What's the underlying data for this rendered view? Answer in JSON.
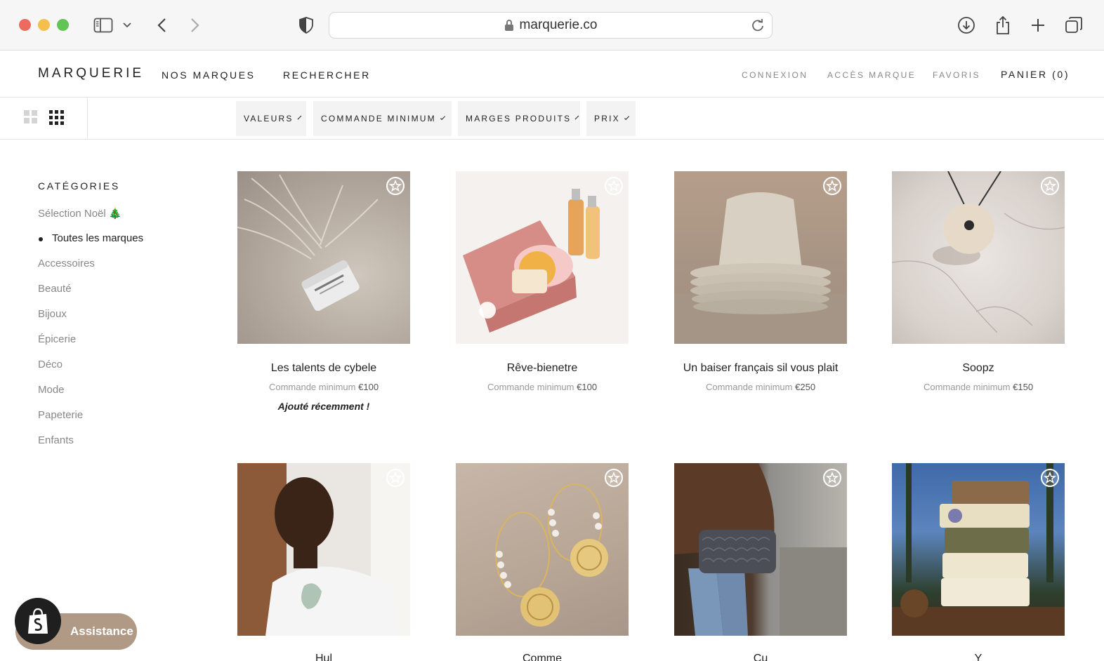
{
  "browser": {
    "url": "marquerie.co"
  },
  "header": {
    "logo": "MARQUERIE",
    "nav": [
      "NOS MARQUES",
      "RECHERCHER"
    ],
    "right_links": [
      "CONNEXION",
      "ACCÈS MARQUE",
      "FAVORIS"
    ],
    "cart": "PANIER (0)"
  },
  "filters": [
    "VALEURS",
    "COMMANDE MINIMUM",
    "MARGES PRODUITS",
    "PRIX"
  ],
  "sidebar": {
    "title": "CATÉGORIES",
    "items": [
      {
        "label": "Sélection Noël 🎄",
        "active": false
      },
      {
        "label": "Toutes les marques",
        "active": true
      },
      {
        "label": "Accessoires",
        "active": false
      },
      {
        "label": "Beauté",
        "active": false
      },
      {
        "label": "Bijoux",
        "active": false
      },
      {
        "label": "Épicerie",
        "active": false
      },
      {
        "label": "Déco",
        "active": false
      },
      {
        "label": "Mode",
        "active": false
      },
      {
        "label": "Papeterie",
        "active": false
      },
      {
        "label": "Enfants",
        "active": false
      }
    ]
  },
  "products": [
    {
      "name": "Les talents de cybele",
      "min_label": "Commande minimum",
      "min_value": "€100",
      "badge": "Ajouté récemment !"
    },
    {
      "name": "Rêve-bienetre",
      "min_label": "Commande minimum",
      "min_value": "€100",
      "badge": ""
    },
    {
      "name": "Un baiser français sil vous plait",
      "min_label": "Commande minimum",
      "min_value": "€250",
      "badge": ""
    },
    {
      "name": "Soopz",
      "min_label": "Commande minimum",
      "min_value": "€150",
      "badge": ""
    },
    {
      "name": "Hul",
      "min_label": "",
      "min_value": "",
      "badge": ""
    },
    {
      "name": "Comme",
      "min_label": "",
      "min_value": "",
      "badge": ""
    },
    {
      "name": "Cu",
      "min_label": "",
      "min_value": "",
      "badge": ""
    },
    {
      "name": "Y",
      "min_label": "",
      "min_value": "",
      "badge": ""
    }
  ],
  "assistance": {
    "label": "Assistance"
  },
  "colors": {
    "accent_assist": "#b09a86",
    "text_primary": "#222222",
    "text_muted": "#888888"
  }
}
